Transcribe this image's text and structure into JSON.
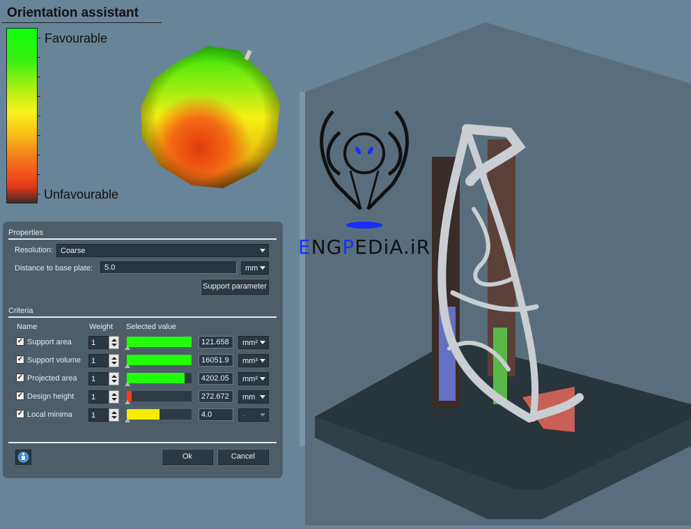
{
  "header": {
    "title": "Orientation assistant"
  },
  "scale": {
    "top_label": "Favourable",
    "bottom_label": "Unfavourable",
    "colors": [
      "#10ff10",
      "#fbf21a",
      "#f04d1a",
      "#3d2a26"
    ]
  },
  "watermark": {
    "text_blue1": "E",
    "text_black1": "NG",
    "text_blue2": "P",
    "text_black2": "EDiA.iR",
    "accent": "#1a2cff"
  },
  "properties": {
    "section_title": "Properties",
    "resolution_label": "Resolution:",
    "resolution_value": "Coarse",
    "distance_label": "Distance to base plate:",
    "distance_value": "5.0",
    "distance_unit": "mm",
    "support_parameter_button": "Support parameter"
  },
  "criteria": {
    "section_title": "Criteria",
    "col_name": "Name",
    "col_weight": "Weight",
    "col_selected": "Selected value",
    "rows": [
      {
        "name": "Support area",
        "checked": true,
        "weight": "1",
        "fill_fraction": 1.0,
        "fill_color": "#22ff08",
        "value": "121.658",
        "unit": "mm²",
        "unit_enabled": true
      },
      {
        "name": "Support volume",
        "checked": true,
        "weight": "1",
        "fill_fraction": 1.0,
        "fill_color": "#22ff08",
        "value": "16051.9",
        "unit": "mm³",
        "unit_enabled": true
      },
      {
        "name": "Projected area",
        "checked": true,
        "weight": "1",
        "fill_fraction": 0.89,
        "fill_color": "#22ff08",
        "value": "4202.05",
        "unit": "mm²",
        "unit_enabled": true
      },
      {
        "name": "Design height",
        "checked": true,
        "weight": "1",
        "fill_fraction": 0.08,
        "fill_color": "#ff3c10",
        "value": "272.672",
        "unit": "mm",
        "unit_enabled": true
      },
      {
        "name": "Local minima",
        "checked": true,
        "weight": "1",
        "fill_fraction": 0.5,
        "fill_color": "#f8ec00",
        "value": "4.0",
        "unit": "-",
        "unit_enabled": false
      }
    ]
  },
  "footer": {
    "ok_label": "Ok",
    "cancel_label": "Cancel"
  }
}
